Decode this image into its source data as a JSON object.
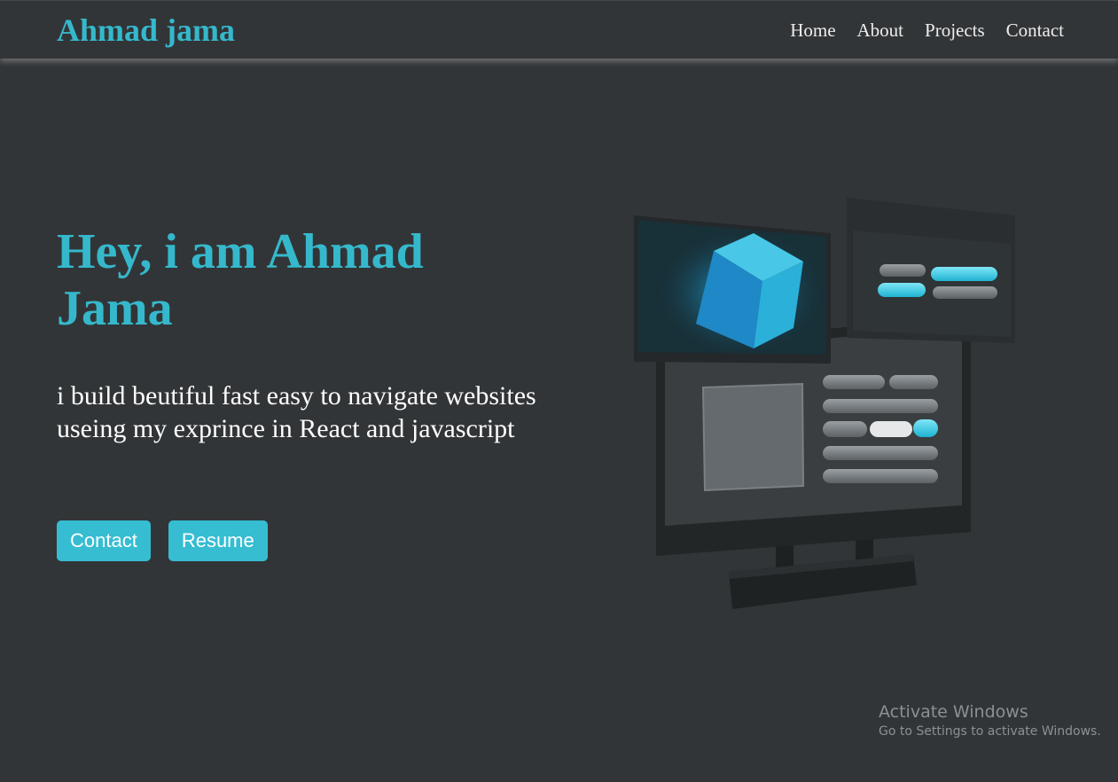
{
  "navbar": {
    "brand": "Ahmad jama",
    "links": [
      {
        "label": "Home"
      },
      {
        "label": "About"
      },
      {
        "label": "Projects"
      },
      {
        "label": "Contact"
      }
    ]
  },
  "hero": {
    "title": "Hey, i am Ahmad Jama",
    "subtitle": "i build beutiful fast easy to navigate websites useing my exprince in React and javascript",
    "buttons": {
      "contact": "Contact",
      "resume": "Resume"
    },
    "illustration_icon": "3d-monitor-ui-illustration"
  },
  "watermark": {
    "title": "Activate Windows",
    "subtitle": "Go to Settings to activate Windows."
  },
  "colors": {
    "background": "#323537",
    "accent": "#35b8cc",
    "text": "#ffffff"
  }
}
